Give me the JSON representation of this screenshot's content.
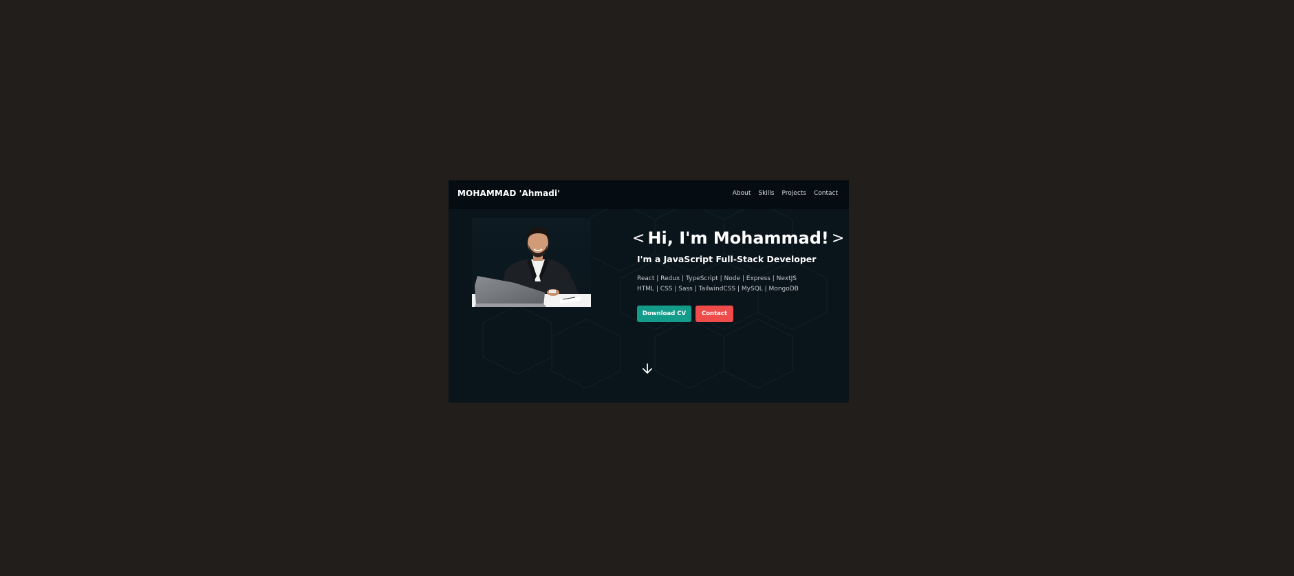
{
  "header": {
    "logo": "MOHAMMAD 'Ahmadi'",
    "nav": [
      "About",
      "Skills",
      "Projects",
      "Contact"
    ]
  },
  "hero": {
    "bracket_left": "<",
    "headline": "Hi, I'm Mohammad!",
    "bracket_right": ">",
    "subtitle": "I'm a JavaScript Full-Stack Developer",
    "tech_line_1": "React | Redux | TypeScript | Node | Express | NextJS",
    "tech_line_2": "HTML | CSS | Sass | TailwindCSS | MySQL | MongoDB",
    "download_label": "Download CV",
    "contact_label": "Contact",
    "scroll_icon": "arrow-down-icon",
    "photo_icon": "profile-photo"
  },
  "colors": {
    "page_bg": "#211e1b",
    "hero_bg": "#0a141b",
    "nav_bg": "#060d12",
    "download_btn": "#139c8a",
    "contact_btn": "#ef4b4b"
  }
}
